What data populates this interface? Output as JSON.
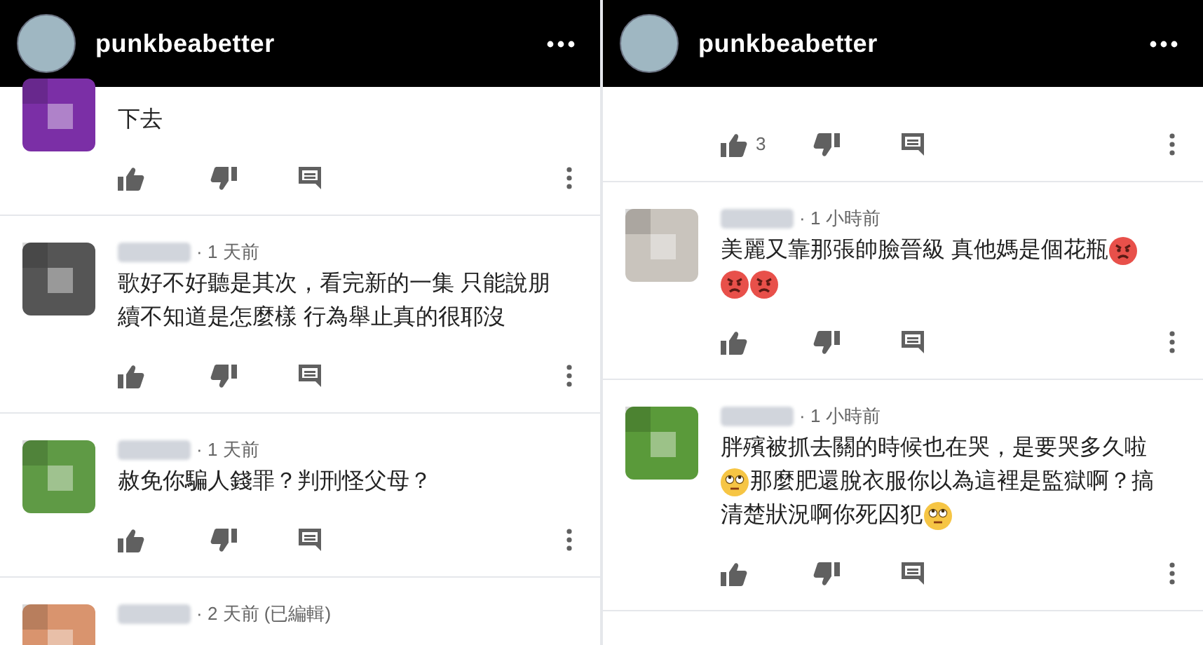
{
  "panels": [
    {
      "header": {
        "username": "punkbeabetter"
      },
      "comments": [
        {
          "color": "#7b2fa6",
          "lines": [
            [
              {
                "kind": "text",
                "text": "下去"
              }
            ]
          ]
        },
        {
          "color": "#555555",
          "time": "· 1 天前",
          "lines": [
            [
              {
                "kind": "text",
                "text": "歌好不好聽是其次，看完新的一集 只能說朋"
              }
            ],
            [
              {
                "kind": "text",
                "text": "續不知道是怎麼樣  行為舉止真的很耶沒"
              }
            ]
          ]
        },
        {
          "color": "#5f9a45",
          "time": "· 1 天前",
          "lines": [
            [
              {
                "kind": "text",
                "text": "赦免你騙人錢罪？判刑怪父母？"
              }
            ]
          ]
        },
        {
          "color": "#d9946e",
          "time": "· 2 天前 (已編輯)",
          "cut": true
        }
      ]
    },
    {
      "header": {
        "username": "punkbeabetter"
      },
      "comments": [
        {
          "likes": "3"
        },
        {
          "color": "#c9c4bd",
          "time": "· 1 小時前",
          "lines": [
            [
              {
                "kind": "text",
                "text": "美麗又靠那張帥臉晉級 真他媽是個花瓶"
              },
              {
                "kind": "angry"
              }
            ],
            [
              {
                "kind": "angry"
              },
              {
                "kind": "angry"
              }
            ]
          ]
        },
        {
          "color": "#5a9a3a",
          "time": "· 1 小時前",
          "lines": [
            [
              {
                "kind": "text",
                "text": "胖殯被抓去關的時候也在哭，是要哭多久啦"
              }
            ],
            [
              {
                "kind": "eyeroll"
              },
              {
                "kind": "text",
                "text": "那麼肥還脫衣服你以為這裡是監獄啊？搞"
              }
            ],
            [
              {
                "kind": "text",
                "text": "清楚狀況啊你死囚犯"
              },
              {
                "kind": "eyeroll"
              }
            ]
          ]
        }
      ]
    }
  ]
}
